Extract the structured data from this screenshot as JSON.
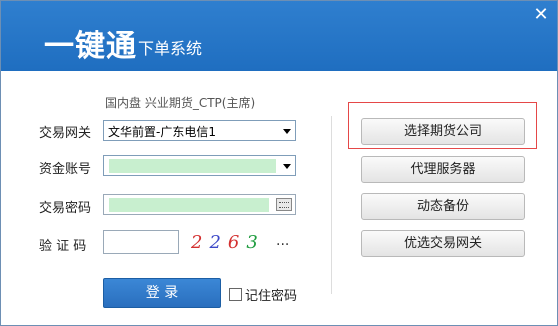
{
  "header": {
    "title": "一键通",
    "subtitle": "下单系统",
    "close_label": "✕"
  },
  "form": {
    "market_text": "国内盘  兴业期货_CTP(主席)",
    "gateway_label": "交易网关",
    "gateway_value": "文华前置-广东电信1",
    "account_label": "资金账号",
    "password_label": "交易密码",
    "captcha_label": "验 证 码",
    "captcha_digits": [
      "2",
      "2",
      "6",
      "3"
    ],
    "captcha_more": "...",
    "login_button": "登 录",
    "remember_label": "记住密码"
  },
  "side_buttons": {
    "select_company": "选择期货公司",
    "proxy_server": "代理服务器",
    "dynamic_backup": "动态备份",
    "preferred_gateway": "优选交易网关"
  }
}
